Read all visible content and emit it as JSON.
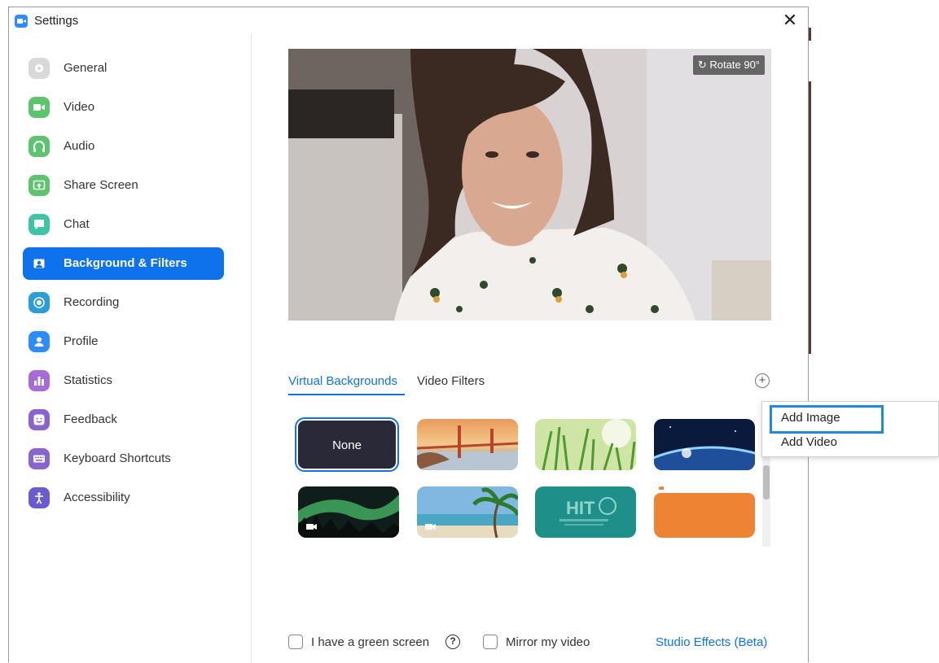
{
  "window": {
    "title": "Settings",
    "close_glyph": "✕"
  },
  "sidebar": {
    "items": [
      {
        "label": "General",
        "icon": "gear-icon",
        "color": "#d9d9d9"
      },
      {
        "label": "Video",
        "icon": "video-camera-icon",
        "color": "#5cc46d"
      },
      {
        "label": "Audio",
        "icon": "headphones-icon",
        "color": "#5cc46d"
      },
      {
        "label": "Share Screen",
        "icon": "share-screen-icon",
        "color": "#5cc46d"
      },
      {
        "label": "Chat",
        "icon": "chat-bubble-icon",
        "color": "#3fc5a3"
      },
      {
        "label": "Background & Filters",
        "icon": "person-portrait-icon",
        "color": "#0e72ed",
        "active": true
      },
      {
        "label": "Recording",
        "icon": "record-icon",
        "color": "#2d9cdb"
      },
      {
        "label": "Profile",
        "icon": "profile-icon",
        "color": "#2d8cff"
      },
      {
        "label": "Statistics",
        "icon": "bar-chart-icon",
        "color": "#a66ad9"
      },
      {
        "label": "Feedback",
        "icon": "smiley-icon",
        "color": "#8a63d2"
      },
      {
        "label": "Keyboard Shortcuts",
        "icon": "keyboard-icon",
        "color": "#8a63d2"
      },
      {
        "label": "Accessibility",
        "icon": "accessibility-icon",
        "color": "#6a5bd2"
      }
    ]
  },
  "preview": {
    "rotate_label": "Rotate 90°"
  },
  "tabs": [
    {
      "label": "Virtual Backgrounds",
      "active": true
    },
    {
      "label": "Video Filters",
      "active": false
    }
  ],
  "add_button_glyph": "+",
  "backgrounds": [
    {
      "name": "none",
      "label": "None"
    },
    {
      "name": "golden-gate"
    },
    {
      "name": "grass"
    },
    {
      "name": "earth-from-space"
    },
    {
      "name": "aurora",
      "video": true
    },
    {
      "name": "beach-palm",
      "video": true
    },
    {
      "name": "hit-logo",
      "text": "HIT"
    },
    {
      "name": "orange"
    }
  ],
  "footer": {
    "green_screen_label": "I have a green screen",
    "help_glyph": "?",
    "mirror_label": "Mirror my video",
    "studio_effects_label": "Studio Effects (Beta)"
  },
  "popup_menu": {
    "items": [
      "Add Image",
      "Add Video"
    ],
    "highlighted": "Add Image"
  }
}
